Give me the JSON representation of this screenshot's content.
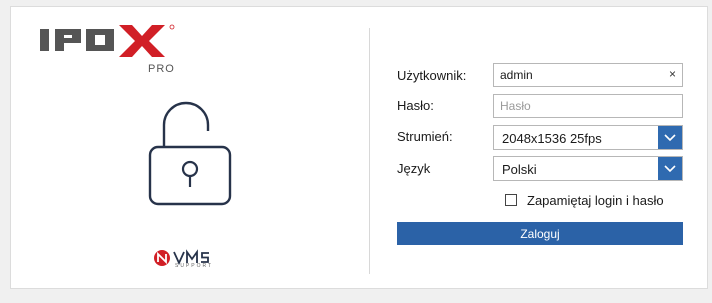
{
  "brand": {
    "logo_text": "IPOX",
    "logo_sub": "PRO",
    "footer_logo": "NVMS",
    "footer_logo_sub": "SUPPORT"
  },
  "icons": {
    "lock": "unlocked-padlock-icon",
    "clear": "close-icon",
    "dropdown": "chevron-down-icon"
  },
  "colors": {
    "accent": "#2b62a7",
    "logo_red": "#d11f26",
    "logo_grey": "#555555",
    "lock_stroke": "#27334a"
  },
  "form": {
    "user_label": "Użytkownik:",
    "user_value": "admin",
    "clear_symbol": "×",
    "password_label": "Hasło:",
    "password_placeholder": "Hasło",
    "stream_label": "Strumień:",
    "stream_value": "2048x1536 25fps",
    "language_label": "Język",
    "language_value": "Polski",
    "remember_label": "Zapamiętaj login i hasło",
    "remember_checked": false,
    "login_button": "Zaloguj"
  }
}
